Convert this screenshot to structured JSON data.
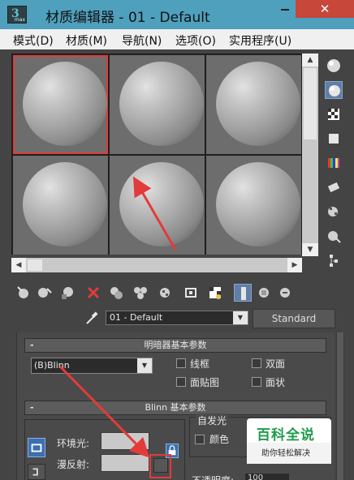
{
  "window": {
    "title": "材质编辑器 - 01 - Default",
    "app_icon_letter": "3",
    "app_icon_sub": "max",
    "minimize_symbol": "—",
    "close_symbol": "✕"
  },
  "menu": [
    {
      "label": "模式(D)"
    },
    {
      "label": "材质(M)"
    },
    {
      "label": "导航(N)"
    },
    {
      "label": "选项(O)"
    },
    {
      "label": "实用程序(U)"
    }
  ],
  "sample_slots": {
    "rows": 2,
    "columns": 3,
    "selected_index": 0
  },
  "side_toolbar": [
    {
      "icon": "sample-type-sphere-icon"
    },
    {
      "icon": "backlight-icon"
    },
    {
      "icon": "background-checker-icon"
    },
    {
      "icon": "sample-uv-tiling-icon"
    },
    {
      "icon": "video-color-check-icon"
    },
    {
      "icon": "make-preview-icon"
    },
    {
      "icon": "options-icon"
    },
    {
      "icon": "select-by-material-icon"
    },
    {
      "icon": "material-map-navigator-icon"
    }
  ],
  "bottom_toolbar": [
    {
      "icon": "get-material-icon"
    },
    {
      "icon": "put-material-to-scene-icon"
    },
    {
      "icon": "assign-material-to-selection-icon"
    },
    {
      "icon": "reset-map-icon"
    },
    {
      "icon": "copy-material-icon"
    },
    {
      "icon": "make-unique-icon"
    },
    {
      "icon": "put-to-library-icon"
    },
    {
      "icon": "material-id-channel-icon"
    },
    {
      "icon": "show-shaded-material-icon"
    },
    {
      "icon": "show-end-result-icon"
    },
    {
      "icon": "go-to-parent-icon"
    },
    {
      "icon": "go-forward-to-sibling-icon"
    }
  ],
  "material": {
    "name": "01 - Default",
    "type_button": "Standard"
  },
  "shader_rollout": {
    "title": "明暗器基本参数",
    "collapse_symbol": "-",
    "shader": "(B)Blinn",
    "options": [
      {
        "label": "线框",
        "checked": false
      },
      {
        "label": "双面",
        "checked": false
      },
      {
        "label": "面贴图",
        "checked": false
      },
      {
        "label": "面状",
        "checked": false
      }
    ]
  },
  "blinn_rollout": {
    "title": "Blinn 基本参数",
    "collapse_symbol": "-",
    "ambient_label": "环境光:",
    "diffuse_label": "漫反射:",
    "self_illumination_label": "自发光",
    "color_label": "颜色",
    "opacity_label": "不透明度:",
    "opacity_value": "100"
  },
  "watermark": {
    "title": "百科全说",
    "subtitle": "助你轻松解决"
  },
  "colors": {
    "titlebar": "#4fa0bd",
    "close": "#c7473b",
    "highlight": "#e33b3b",
    "active_button": "#5f7ea8"
  }
}
